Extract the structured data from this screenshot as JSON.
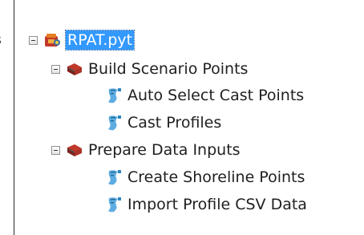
{
  "left_fragment": "s",
  "tree": {
    "root": {
      "label": "RPAT.pyt",
      "expanded": true,
      "selected": true,
      "icon": "python-toolbox-icon"
    },
    "toolsets": [
      {
        "label": "Build Scenario Points",
        "expanded": true,
        "icon": "toolset-icon",
        "tools": [
          {
            "label": "Auto Select Cast Points",
            "icon": "script-tool-icon"
          },
          {
            "label": "Cast Profiles",
            "icon": "script-tool-icon"
          }
        ]
      },
      {
        "label": "Prepare Data Inputs",
        "expanded": true,
        "icon": "toolset-icon",
        "tools": [
          {
            "label": "Create Shoreline Points",
            "icon": "script-tool-icon"
          },
          {
            "label": "Import Profile CSV Data",
            "icon": "script-tool-icon"
          }
        ]
      }
    ]
  },
  "colors": {
    "selection": "#3399ff",
    "selection_text": "#ffffff",
    "text": "#1f1f1f"
  }
}
